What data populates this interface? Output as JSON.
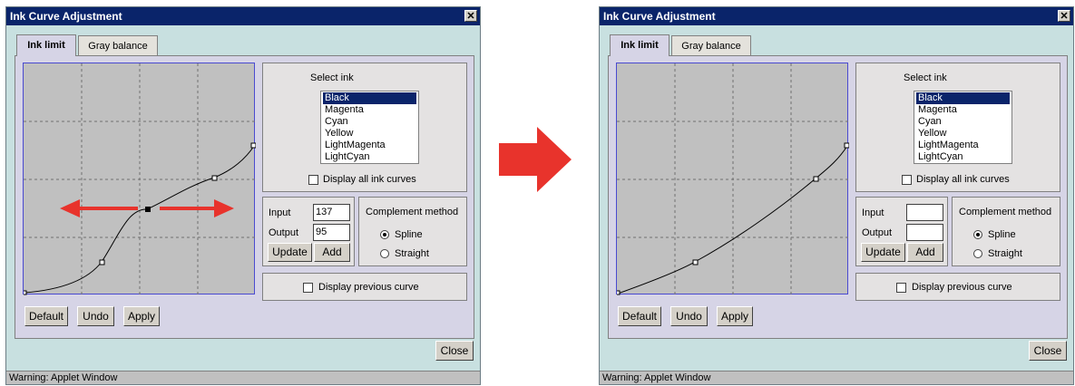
{
  "dialog": {
    "title": "Ink Curve Adjustment",
    "close_glyph": "✕",
    "tabs": [
      "Ink limit",
      "Gray balance"
    ],
    "select_ink_label": "Select ink",
    "inks": [
      "Black",
      "Magenta",
      "Cyan",
      "Yellow",
      "LightMagenta",
      "LightCyan"
    ],
    "selected_ink": "Black",
    "display_all_label": "Display all ink curves",
    "input_label": "Input",
    "output_label": "Output",
    "update_label": "Update",
    "add_label": "Add",
    "complement_label": "Complement method",
    "spline_label": "Spline",
    "straight_label": "Straight",
    "display_prev_label": "Display previous curve",
    "default_label": "Default",
    "undo_label": "Undo",
    "apply_label": "Apply",
    "close_label": "Close",
    "status": "Warning: Applet Window"
  },
  "before": {
    "input_value": "137",
    "output_value": "95",
    "complement": "Spline"
  },
  "after": {
    "input_value": "",
    "output_value": "",
    "complement": "Spline"
  },
  "colors": {
    "titlebar": "#0a246a",
    "window_bg": "#c8e0e0",
    "panel_bg": "#d6d4e6",
    "graph_bg": "#c0c0c0",
    "arrow": "#e8332c",
    "selection": "#0a246a"
  }
}
